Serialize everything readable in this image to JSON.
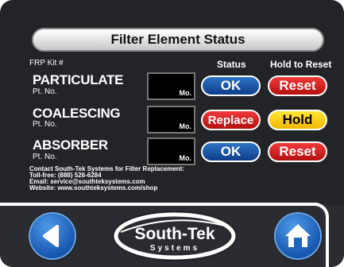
{
  "title": "Filter Element Status",
  "headers": {
    "kit": "FRP Kit #",
    "status": "Status",
    "hold": "Hold to Reset"
  },
  "rows": [
    {
      "name": "PARTICULATE",
      "pt_no": "Pt. No.",
      "mo": "Mo.",
      "status": "OK",
      "status_color": "#1b4fa3",
      "action": "Reset",
      "action_color": "#e02020"
    },
    {
      "name": "COALESCING",
      "pt_no": "Pt. No.",
      "mo": "Mo.",
      "status": "Replace",
      "status_color": "#e02020",
      "action": "Hold",
      "action_color": "#f6c700"
    },
    {
      "name": "ABSORBER",
      "pt_no": "Pt. No.",
      "mo": "Mo.",
      "status": "OK",
      "status_color": "#1b4fa3",
      "action": "Reset",
      "action_color": "#e02020"
    }
  ],
  "contact": {
    "line1": "Contact South-Tek Systems for Filter Replacement:",
    "line2": "Toll-free: (888) 526-6284",
    "line3": "Email: service@southteksystems.com",
    "line4": "Website: www.southteksystems.com/shop"
  },
  "logo": {
    "brand": "South-Tek",
    "sub": "Systems"
  },
  "icons": {
    "back": "back-arrow-icon",
    "home": "home-icon"
  },
  "colors": {
    "background": "#222427",
    "blue": "#1b4fa3",
    "red": "#e02020",
    "yellow": "#f6c700"
  }
}
